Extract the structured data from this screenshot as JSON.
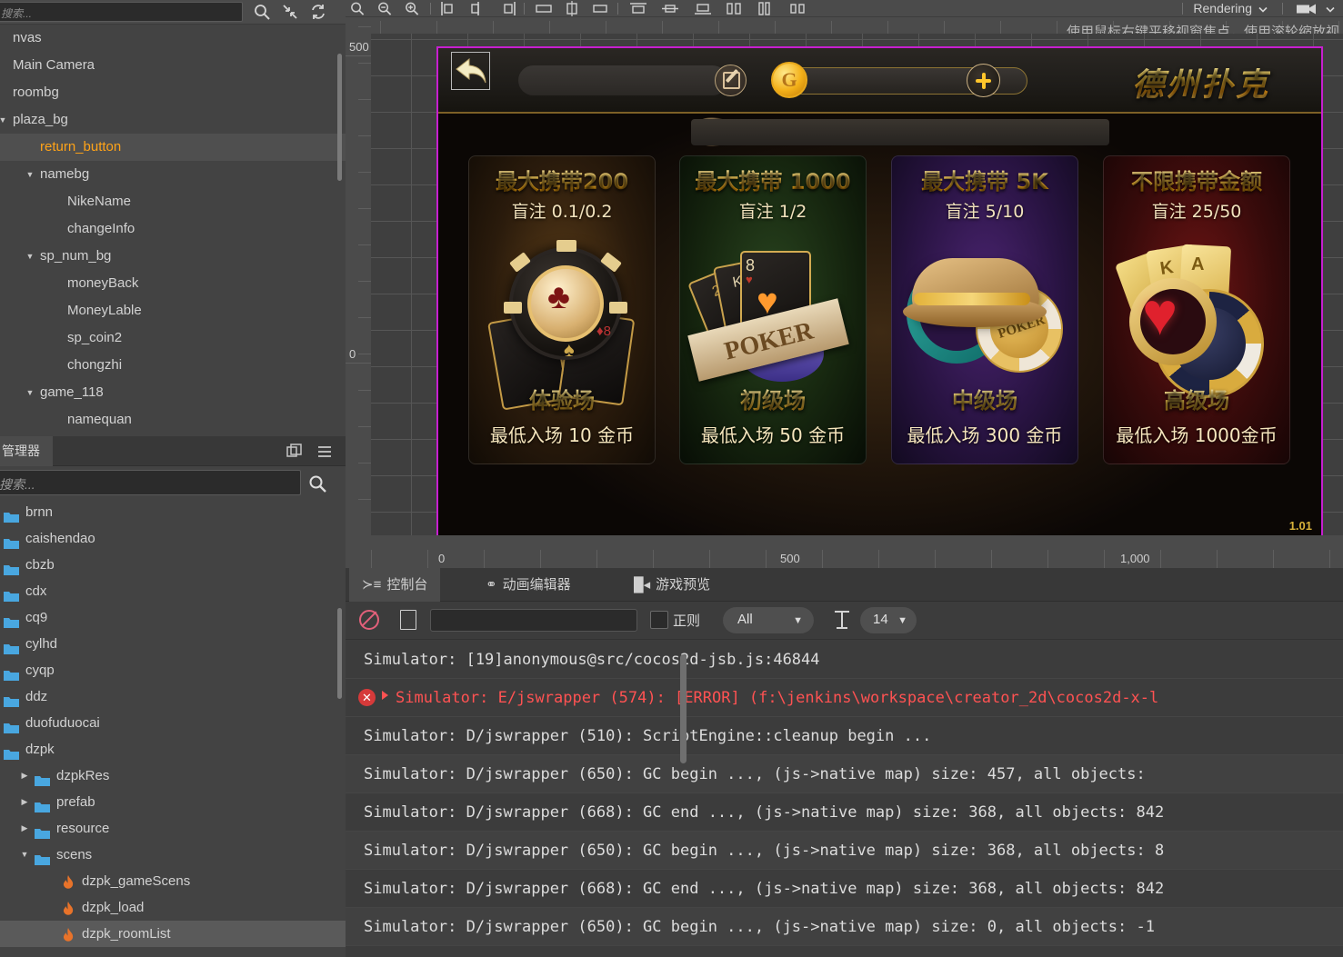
{
  "hierarchy": {
    "search_placeholder": "搜索...",
    "icons": [
      "search-icon",
      "collapse-icon",
      "refresh-icon"
    ],
    "nodes": [
      {
        "label": "nvas",
        "depth": 0,
        "twirl": "",
        "selected": false
      },
      {
        "label": "Main Camera",
        "depth": 0,
        "twirl": "",
        "selected": false
      },
      {
        "label": "roombg",
        "depth": 0,
        "twirl": "",
        "selected": false
      },
      {
        "label": "plaza_bg",
        "depth": 0,
        "twirl": "down",
        "selected": false
      },
      {
        "label": "return_button",
        "depth": 1,
        "twirl": "",
        "selected": true
      },
      {
        "label": "namebg",
        "depth": 1,
        "twirl": "down",
        "selected": false
      },
      {
        "label": "NikeName",
        "depth": 2,
        "twirl": "",
        "selected": false
      },
      {
        "label": "changeInfo",
        "depth": 2,
        "twirl": "",
        "selected": false
      },
      {
        "label": "sp_num_bg",
        "depth": 1,
        "twirl": "down",
        "selected": false
      },
      {
        "label": "moneyBack",
        "depth": 2,
        "twirl": "",
        "selected": false
      },
      {
        "label": "MoneyLable",
        "depth": 2,
        "twirl": "",
        "selected": false
      },
      {
        "label": "sp_coin2",
        "depth": 2,
        "twirl": "",
        "selected": false
      },
      {
        "label": "chongzhi",
        "depth": 2,
        "twirl": "",
        "selected": false
      },
      {
        "label": "game_118",
        "depth": 1,
        "twirl": "down",
        "selected": false
      },
      {
        "label": "namequan",
        "depth": 2,
        "twirl": "",
        "selected": false
      }
    ]
  },
  "assets": {
    "tab_label": "管理器",
    "search_placeholder": "搜索...",
    "icons": [
      "duplicate-icon",
      "menu-icon",
      "search-icon"
    ],
    "items": [
      {
        "label": "brnn",
        "depth": 0,
        "type": "folder",
        "twirl": "",
        "selected": false
      },
      {
        "label": "caishendao",
        "depth": 0,
        "type": "folder",
        "twirl": "",
        "selected": false
      },
      {
        "label": "cbzb",
        "depth": 0,
        "type": "folder",
        "twirl": "",
        "selected": false
      },
      {
        "label": "cdx",
        "depth": 0,
        "type": "folder",
        "twirl": "",
        "selected": false
      },
      {
        "label": "cq9",
        "depth": 0,
        "type": "folder",
        "twirl": "",
        "selected": false
      },
      {
        "label": "cylhd",
        "depth": 0,
        "type": "folder",
        "twirl": "",
        "selected": false
      },
      {
        "label": "cyqp",
        "depth": 0,
        "type": "folder",
        "twirl": "",
        "selected": false
      },
      {
        "label": "ddz",
        "depth": 0,
        "type": "folder",
        "twirl": "",
        "selected": false
      },
      {
        "label": "duofuduocai",
        "depth": 0,
        "type": "folder",
        "twirl": "",
        "selected": false
      },
      {
        "label": "dzpk",
        "depth": 0,
        "type": "folder",
        "twirl": "",
        "selected": false
      },
      {
        "label": "dzpkRes",
        "depth": 1,
        "type": "folder",
        "twirl": "right",
        "selected": false
      },
      {
        "label": "prefab",
        "depth": 1,
        "type": "folder",
        "twirl": "right",
        "selected": false
      },
      {
        "label": "resource",
        "depth": 1,
        "type": "folder",
        "twirl": "right",
        "selected": false
      },
      {
        "label": "scens",
        "depth": 1,
        "type": "folder",
        "twirl": "down",
        "selected": false
      },
      {
        "label": "dzpk_gameScens",
        "depth": 2,
        "type": "scene",
        "twirl": "",
        "selected": false
      },
      {
        "label": "dzpk_load",
        "depth": 2,
        "type": "scene",
        "twirl": "",
        "selected": false
      },
      {
        "label": "dzpk_roomList",
        "depth": 2,
        "type": "scene",
        "twirl": "",
        "selected": true
      }
    ]
  },
  "scene": {
    "rendering_label": "Rendering",
    "hint": "使用鼠标右键平移视窗焦点，使用滚轮缩放视",
    "scale_label": "1.01",
    "selected_node_tag": "return_button",
    "ruler_v_labels": [
      "500",
      "0"
    ],
    "ruler_h_labels": [
      "0",
      "500",
      "1,000"
    ]
  },
  "game": {
    "title": "德州扑克",
    "topbar_icons": [
      "back-arrow-icon",
      "edit-icon",
      "coin-icon",
      "plus-icon"
    ],
    "cards": [
      {
        "id": "c0",
        "max_carry": "最大携带200",
        "blind": "盲注 0.1/0.2",
        "room_name": "体验场",
        "entry_fee": "最低入场 10 金币",
        "theme": "#5a3c18"
      },
      {
        "id": "c1",
        "max_carry": "最大携带 1000",
        "blind": "盲注 1/2",
        "room_name": "初级场",
        "entry_fee": "最低入场 50 金币",
        "theme": "#29441f"
      },
      {
        "id": "c2",
        "max_carry": "最大携带 5K",
        "blind": "盲注 5/10",
        "room_name": "中级场",
        "entry_fee": "最低入场 300 金币",
        "theme": "#4a2470"
      },
      {
        "id": "c3",
        "max_carry": "不限携带金额",
        "blind": "盲注 25/50",
        "room_name": "高级场",
        "entry_fee": "最低入场 1000金币",
        "theme": "#6e1414"
      }
    ]
  },
  "console": {
    "tabs": [
      {
        "label": "控制台",
        "icon": "console-icon",
        "active": true
      },
      {
        "label": "动画编辑器",
        "icon": "animation-icon",
        "active": false
      },
      {
        "label": "游戏预览",
        "icon": "camera-icon",
        "active": false
      }
    ],
    "toolbar": {
      "clear_icon": "ban-icon",
      "file_icon": "document-icon",
      "filter_value": "",
      "regex_label": "正则",
      "level_value": "All",
      "level_arrow": "▼",
      "font_icon": "text-size-icon",
      "font_size_value": "14",
      "font_size_arrow": "▼"
    },
    "logs": [
      {
        "text": "Simulator: [19]anonymous@src/cocos2d-jsb.js:46844",
        "type": "info"
      },
      {
        "text": "Simulator: E/jswrapper (574): [ERROR] (f:\\jenkins\\workspace\\creator_2d\\cocos2d-x-l",
        "type": "error"
      },
      {
        "text": "Simulator: D/jswrapper (510): ScriptEngine::cleanup begin ...",
        "type": "info"
      },
      {
        "text": "Simulator: D/jswrapper (650): GC begin ..., (js->native map) size: 457, all objects:",
        "type": "info"
      },
      {
        "text": "Simulator: D/jswrapper (668): GC end ..., (js->native map) size: 368, all objects: 842",
        "type": "info"
      },
      {
        "text": "Simulator: D/jswrapper (650): GC begin ..., (js->native map) size: 368, all objects: 8",
        "type": "info"
      },
      {
        "text": "Simulator: D/jswrapper (668): GC end ..., (js->native map) size: 368, all objects: 842",
        "type": "info"
      },
      {
        "text": "Simulator: D/jswrapper (650): GC begin ..., (js->native map) size: 0, all objects: -1",
        "type": "info"
      }
    ]
  }
}
